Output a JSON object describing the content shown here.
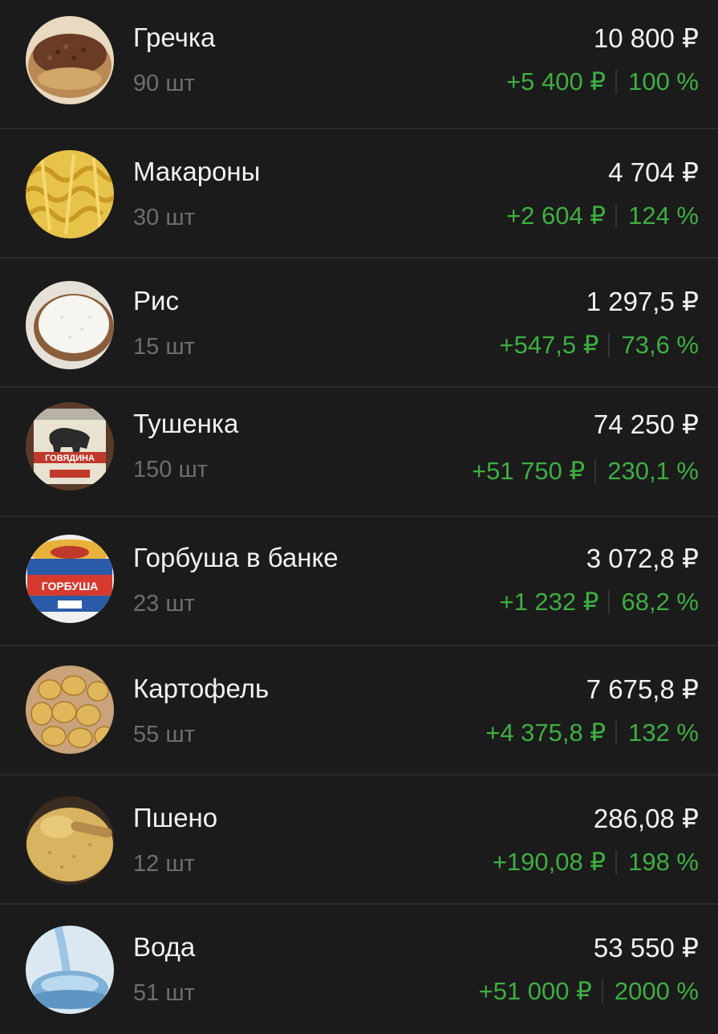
{
  "items": [
    {
      "name": "Гречка",
      "qty": "90 шт",
      "total": "10 800 ₽",
      "gain": "+5 400 ₽",
      "pct": "100 %",
      "icon": "buckwheat-icon"
    },
    {
      "name": "Макароны",
      "qty": "30 шт",
      "total": "4 704 ₽",
      "gain": "+2 604 ₽",
      "pct": "124 %",
      "icon": "pasta-icon"
    },
    {
      "name": "Рис",
      "qty": "15 шт",
      "total": "1 297,5 ₽",
      "gain": "+547,5 ₽",
      "pct": "73,6 %",
      "icon": "rice-icon"
    },
    {
      "name": "Тушенка",
      "qty": "150 шт",
      "total": "74 250 ₽",
      "gain": "+51 750 ₽",
      "pct": "230,1 %",
      "icon": "canned-beef-icon",
      "label": "ГОВЯДИНА"
    },
    {
      "name": "Горбуша в банке",
      "qty": "23 шт",
      "total": "3 072,8 ₽",
      "gain": "+1 232 ₽",
      "pct": "68,2 %",
      "icon": "canned-salmon-icon",
      "label": "ГОРБУША"
    },
    {
      "name": "Картофель",
      "qty": "55 шт",
      "total": "7 675,8 ₽",
      "gain": "+4 375,8 ₽",
      "pct": "132 %",
      "icon": "potato-icon"
    },
    {
      "name": "Пшено",
      "qty": "12 шт",
      "total": "286,08 ₽",
      "gain": "+190,08 ₽",
      "pct": "198 %",
      "icon": "millet-icon"
    },
    {
      "name": "Вода",
      "qty": "51 шт",
      "total": "53 550 ₽",
      "gain": "+51 000 ₽",
      "pct": "2000 %",
      "icon": "water-icon"
    }
  ],
  "colors": {
    "background": "#1b1b1b",
    "gain": "#3fae43",
    "muted": "#6e6e6e",
    "text": "#f2f2f2"
  }
}
